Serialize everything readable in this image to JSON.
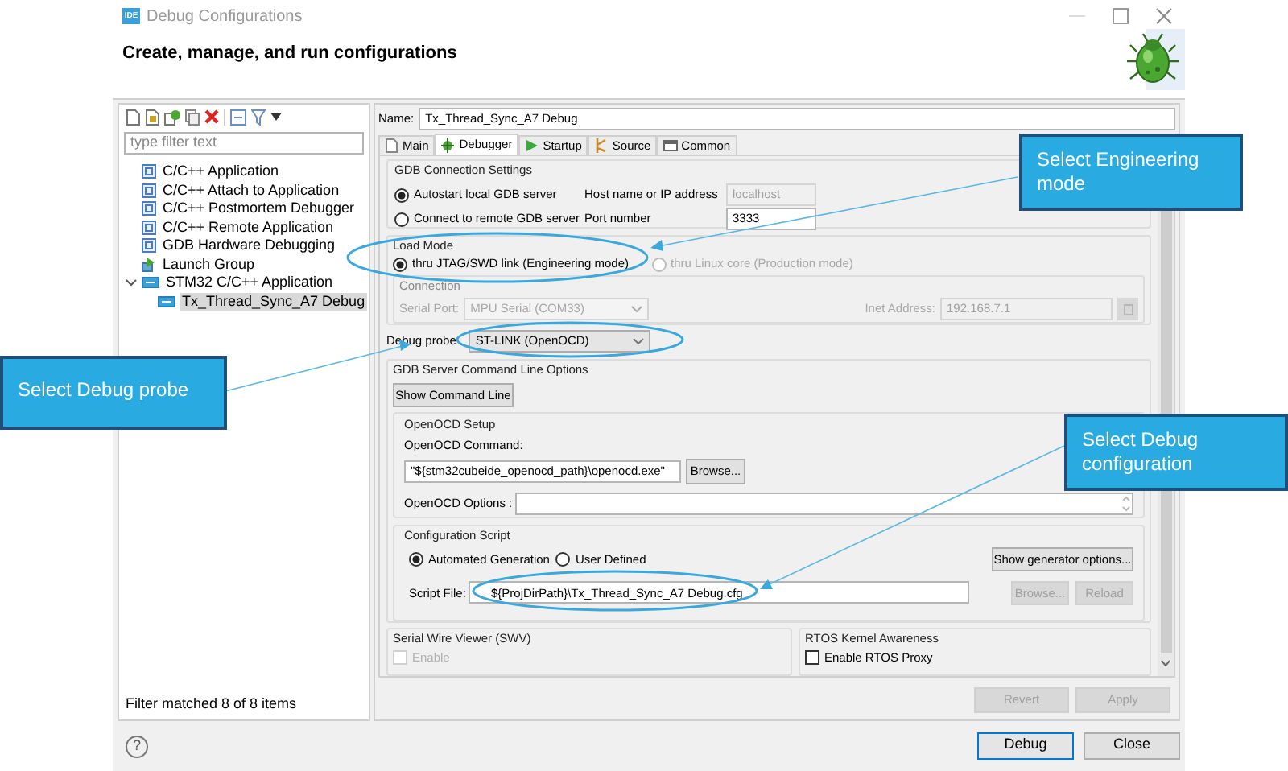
{
  "window": {
    "app_badge": "IDE",
    "title": "Debug Configurations"
  },
  "header": {
    "title": "Create, manage, and run configurations"
  },
  "filter": {
    "placeholder": "type filter text"
  },
  "tree": [
    {
      "label": "C/C++ Application",
      "kind": "c",
      "selected": false
    },
    {
      "label": "C/C++ Attach to Application",
      "kind": "c",
      "selected": false
    },
    {
      "label": "C/C++ Postmortem Debugger",
      "kind": "c",
      "selected": false
    },
    {
      "label": "C/C++ Remote Application",
      "kind": "c",
      "selected": false
    },
    {
      "label": "GDB Hardware Debugging",
      "kind": "c",
      "selected": false
    },
    {
      "label": "Launch Group",
      "kind": "group",
      "selected": false
    },
    {
      "label": "STM32 C/C++ Application",
      "kind": "stm32",
      "selected": false,
      "expanded": true,
      "children": [
        {
          "label": "Tx_Thread_Sync_A7 Debug",
          "kind": "stm32",
          "selected": true
        }
      ]
    }
  ],
  "filter_status": "Filter matched 8 of 8 items",
  "name_field": {
    "label": "Name:",
    "value": "Tx_Thread_Sync_A7 Debug"
  },
  "tabs": [
    {
      "label": "Main",
      "selected": false
    },
    {
      "label": "Debugger",
      "selected": true
    },
    {
      "label": "Startup",
      "selected": false
    },
    {
      "label": "Source",
      "selected": false
    },
    {
      "label": "Common",
      "selected": false
    }
  ],
  "gdb_connection": {
    "title": "GDB Connection Settings",
    "options": [
      {
        "label": "Autostart local GDB server",
        "selected": true
      },
      {
        "label": "Connect to remote GDB server",
        "selected": false
      }
    ],
    "host": {
      "label": "Host name or IP address",
      "value": "localhost",
      "disabled": true
    },
    "port": {
      "label": "Port number",
      "value": "3333",
      "disabled": false
    }
  },
  "load_mode": {
    "title": "Load Mode",
    "options": [
      {
        "label": "thru JTAG/SWD link (Engineering mode)",
        "selected": true,
        "disabled": false
      },
      {
        "label": "thru Linux core (Production mode)",
        "selected": false,
        "disabled": true
      }
    ],
    "connection": {
      "title": "Connection",
      "disabled": true,
      "serial_port": {
        "label": "Serial Port:",
        "value": "MPU Serial (COM33)"
      },
      "inet_address": {
        "label": "Inet Address:",
        "value": "192.168.7.1"
      }
    }
  },
  "debug_probe": {
    "label": "Debug probe",
    "value": "ST-LINK (OpenOCD)"
  },
  "gdb_server_options": {
    "title": "GDB Server Command Line Options",
    "show_command_line": "Show Command Line",
    "openocd_setup": {
      "title": "OpenOCD Setup",
      "command_label": "OpenOCD Command:",
      "command_value": "\"${stm32cubeide_openocd_path}\\openocd.exe\"",
      "browse": "Browse...",
      "options_label": "OpenOCD Options :"
    },
    "configuration_script": {
      "title": "Configuration Script",
      "options": [
        {
          "label": "Automated Generation",
          "selected": true
        },
        {
          "label": "User Defined",
          "selected": false
        }
      ],
      "generator_button": "Show generator options...",
      "script_file": {
        "label": "Script File:",
        "value": "${ProjDirPath}\\Tx_Thread_Sync_A7 Debug.cfg"
      },
      "buttons": [
        {
          "label": "Browse...",
          "disabled": true
        },
        {
          "label": "Reload",
          "disabled": true
        }
      ]
    }
  },
  "swv": {
    "title": "Serial Wire Viewer (SWV)",
    "enable": {
      "label": "Enable",
      "checked": false,
      "disabled": true
    }
  },
  "rtos": {
    "title": "RTOS Kernel Awareness",
    "enable": {
      "label": "Enable RTOS Proxy",
      "checked": false,
      "disabled": false
    }
  },
  "panel_buttons": [
    {
      "label": "Revert",
      "disabled": true
    },
    {
      "label": "Apply",
      "disabled": true
    }
  ],
  "help_button": "?",
  "dialog_buttons": [
    {
      "label": "Debug",
      "default": true
    },
    {
      "label": "Close",
      "default": false
    }
  ],
  "callouts": [
    {
      "text": "Select Engineering mode"
    },
    {
      "text": "Select Debug probe"
    },
    {
      "text": "Select Debug configuration"
    }
  ]
}
